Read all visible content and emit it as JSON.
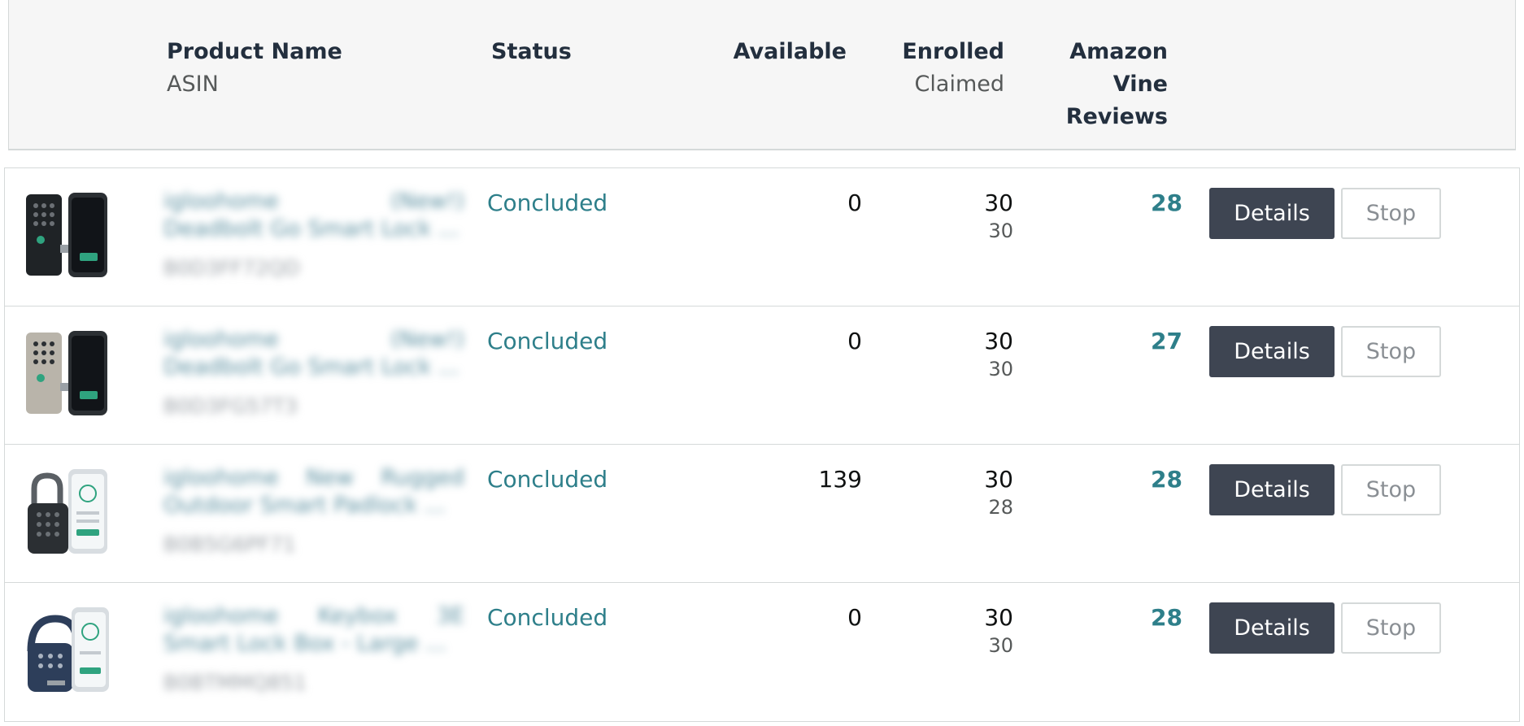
{
  "header": {
    "product_name": "Product Name",
    "asin": "ASIN",
    "status": "Status",
    "available": "Available",
    "enrolled": "Enrolled",
    "claimed": "Claimed",
    "vine_line1": "Amazon",
    "vine_line2": "Vine",
    "vine_line3": "Reviews"
  },
  "rows": [
    {
      "product_name": "igloohome (New!) Deadbolt Go Smart Lock ...",
      "asin": "B0D3FF72QD",
      "status": "Concluded",
      "available": "0",
      "enrolled": "30",
      "claimed": "30",
      "reviews": "28",
      "details_label": "Details",
      "stop_label": "Stop",
      "thumb_icon": "smart-deadbolt-black-thumbnail"
    },
    {
      "product_name": "igloohome (New!) Deadbolt Go Smart Lock ...",
      "asin": "B0D3FG57T3",
      "status": "Concluded",
      "available": "0",
      "enrolled": "30",
      "claimed": "30",
      "reviews": "27",
      "details_label": "Details",
      "stop_label": "Stop",
      "thumb_icon": "smart-deadbolt-silver-thumbnail"
    },
    {
      "product_name": "igloohome New Rugged Outdoor Smart Padlock ...",
      "asin": "B0B5G6PF71",
      "status": "Concluded",
      "available": "139",
      "enrolled": "30",
      "claimed": "28",
      "reviews": "28",
      "details_label": "Details",
      "stop_label": "Stop",
      "thumb_icon": "smart-padlock-thumbnail"
    },
    {
      "product_name": "igloohome Keybox 3E Smart Lock Box - Large ...",
      "asin": "B0BTMMQ851",
      "status": "Concluded",
      "available": "0",
      "enrolled": "30",
      "claimed": "30",
      "reviews": "28",
      "details_label": "Details",
      "stop_label": "Stop",
      "thumb_icon": "smart-keybox-thumbnail"
    }
  ],
  "colors": {
    "status_teal": "#2e7f8a",
    "details_button_bg": "#3e4552",
    "header_bg": "#f6f6f6"
  }
}
